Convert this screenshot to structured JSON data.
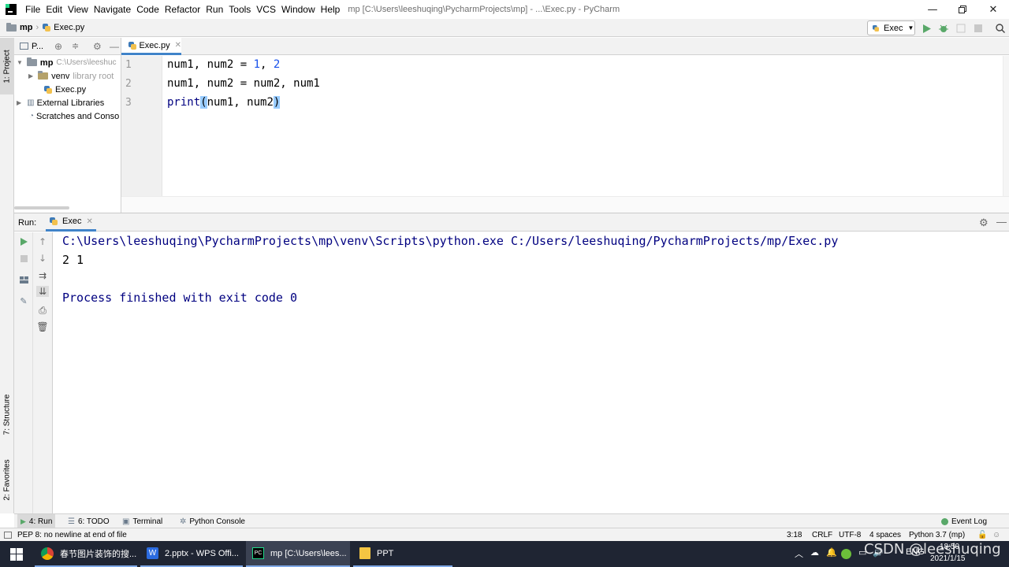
{
  "menu": {
    "items": [
      "File",
      "Edit",
      "View",
      "Navigate",
      "Code",
      "Refactor",
      "Run",
      "Tools",
      "VCS",
      "Window",
      "Help"
    ],
    "window_title": "mp [C:\\Users\\leeshuqing\\PycharmProjects\\mp] - ...\\Exec.py - PyCharm"
  },
  "navbar": {
    "project": "mp",
    "file": "Exec.py",
    "run_config": "Exec"
  },
  "side_tabs": {
    "project": "1: Project",
    "structure": "7: Structure",
    "favorites": "2: Favorites"
  },
  "project_panel": {
    "header": "P...",
    "root_name": "mp",
    "root_path": "C:\\Users\\leeshuc",
    "venv_name": "venv",
    "venv_note": "library root",
    "file": "Exec.py",
    "ext_libs": "External Libraries",
    "scratches": "Scratches and Conso"
  },
  "editor": {
    "tab": "Exec.py",
    "line_numbers": [
      "1",
      "2",
      "3"
    ],
    "line1": {
      "a": "num1, num2 = ",
      "n1": "1",
      "sep": ", ",
      "n2": "2"
    },
    "line2": "num1, num2 = num2, num1",
    "line3": {
      "fn": "print",
      "open": "(",
      "args": "num1, num2",
      "close": ")"
    }
  },
  "run_panel": {
    "label": "Run:",
    "tab": "Exec",
    "console": {
      "cmd": "C:\\Users\\leeshuqing\\PycharmProjects\\mp\\venv\\Scripts\\python.exe C:/Users/leeshuqing/PycharmProjects/mp/Exec.py",
      "output": "2 1",
      "exit": "Process finished with exit code 0"
    }
  },
  "bottom_tabs": {
    "run": "4: Run",
    "todo": "6: TODO",
    "terminal": "Terminal",
    "python_console": "Python Console",
    "event_log": "Event Log"
  },
  "status": {
    "message": "PEP 8: no newline at end of file",
    "position": "3:18",
    "line_sep": "CRLF",
    "encoding": "UTF-8",
    "indent": "4 spaces",
    "interpreter": "Python 3.7 (mp)"
  },
  "taskbar": {
    "items": [
      "春节图片装饰的搜...",
      "2.pptx - WPS Offi...",
      "mp [C:\\Users\\lees...",
      "PPT"
    ],
    "tray_lang": "ENG",
    "time": "18:50",
    "date": "2021/1/15"
  },
  "watermark": "CSDN @leeshuqing",
  "colors": {
    "keyword_blue": "#000080",
    "number_blue": "#1750eb",
    "accent": "#4083c9",
    "run_green": "#59a869"
  }
}
